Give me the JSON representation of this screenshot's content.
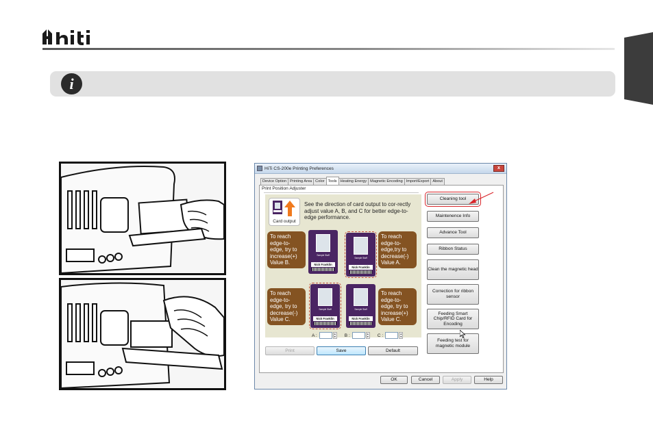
{
  "brand": {
    "logo_text": "hiti"
  },
  "info_icon": "info-icon",
  "dialog": {
    "title": "HiTi CS-200e Printing Preferences",
    "close_label": "x",
    "tabs": [
      "Device Option",
      "Printing Area",
      "Color",
      "Tools",
      "Heating Energy",
      "Magnetic Encoding",
      "Import/Export",
      "About"
    ],
    "active_tab": "Tools",
    "group_label": "Print Position Adjuster",
    "card_output_label": "Card output",
    "instruction": "See the direction of card output to cor-rectly adjust value A, B, and C for better edge-to-edge performance.",
    "hints": {
      "top_left": "To reach edge-to-edge, try to increase(+) Value B.",
      "top_right": "To reach edge-to-edge,try to decrease(-) Value A.",
      "bottom_left": "To reach edge-to-edge, try to decrease(-) Value C.",
      "bottom_right": "To reach edge-to-edge, try to increase(+) Value C."
    },
    "card": {
      "name": "Nick Franklin",
      "subtitle": "Sample Staff"
    },
    "fields": [
      {
        "label": "A :",
        "value": ""
      },
      {
        "label": "B :",
        "value": ""
      },
      {
        "label": "C :",
        "value": ""
      }
    ],
    "adjuster_buttons": {
      "print": "Print",
      "save": "Save",
      "default": "Default"
    },
    "tool_buttons": [
      "Cleaning tool",
      "Maintenence Info",
      "Advance Tool",
      "Ribbon Status",
      "Clean the magnetic head",
      "Correction for ribbon sensor",
      "Feeding Smart Chip/RFID Card for Encoding",
      "Feeding test for magnetic module"
    ],
    "footer_buttons": {
      "ok": "OK",
      "cancel": "Cancel",
      "apply": "Apply",
      "help": "Help"
    }
  },
  "colors": {
    "accent_red": "#d9252a",
    "hint_brown": "#845322",
    "card_purple": "#4a2563",
    "adjuster_bg": "#e7e6d1"
  }
}
